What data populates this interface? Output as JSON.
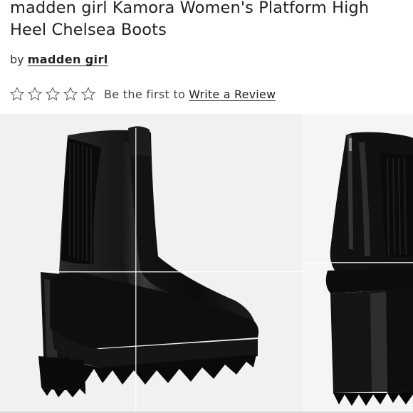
{
  "product": {
    "title": "madden girl Kamora Women's Platform High Heel Chelsea Boots",
    "by_prefix": "by",
    "brand": "madden girl"
  },
  "rating": {
    "stars_filled": 0,
    "stars_total": 5,
    "prompt": "Be the first to",
    "review_link": "Write a Review"
  },
  "gallery": {
    "images": [
      {
        "alt": "Kamora boot front three-quarter view"
      },
      {
        "alt": "Kamora boot side view"
      }
    ]
  },
  "colors": {
    "text": "#222222",
    "star_outline": "#555555",
    "gallery_bg": "#f2f2f2"
  }
}
